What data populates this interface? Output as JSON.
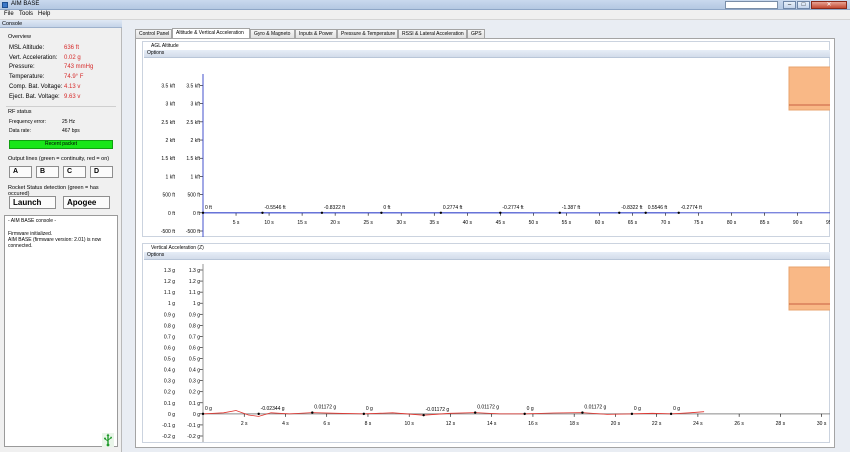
{
  "window": {
    "title": "AIM BASE"
  },
  "menu": [
    "File",
    "Tools",
    "Help"
  ],
  "console": {
    "header": "Console",
    "overview_label": "Overview",
    "fields": [
      {
        "label": "MSL Altitude:",
        "value": "636 ft"
      },
      {
        "label": "Vert. Acceleration:",
        "value": "0.02 g"
      },
      {
        "label": "Pressure:",
        "value": "743 mmHg"
      },
      {
        "label": "Temperature:",
        "value": "74.9° F"
      },
      {
        "label": "Comp. Bat. Voltage:",
        "value": "4.13 v"
      },
      {
        "label": "Eject. Bat. Voltage:",
        "value": "9.63 v"
      }
    ],
    "rf_label": "RF status",
    "rf": [
      {
        "label": "Frequency error:",
        "value": "25 Hz"
      },
      {
        "label": "Data rate:",
        "value": "467 bps"
      }
    ],
    "recent_packet": "Recent packet",
    "output_label": "Output lines (green = continuity, red = on)",
    "output_buttons": [
      "A",
      "B",
      "C",
      "D"
    ],
    "detect_label": "Rocket Status detection (green = has occured)",
    "launch": "Launch",
    "apogee": "Apogee",
    "log_title": "- AIM BASE console -",
    "log_text": "Firmware initialized.\nAIM BASE (firmware version: 2.01) is now connected."
  },
  "tabs": [
    "Control Panel",
    "Altitude & Vertical Acceleration",
    "Gyro & Magneto",
    "Inputs & Power",
    "Pressure & Temperature",
    "RSSI & Lateral Acceleration",
    "GPS"
  ],
  "active_tab": 1,
  "colors": {
    "accent_line": "#2f3fc9",
    "accel_line": "#e0302a",
    "overview_box": "#f9b886",
    "recent_packet": "#19e619",
    "value_text": "#d62a2a"
  },
  "chart_data": [
    {
      "type": "line",
      "title": "AGL Altitude",
      "options_label": "Options",
      "y_ticks": [
        "-500 ft",
        "0 ft",
        "500 ft",
        "1 kft",
        "1.5 kft",
        "2 kft",
        "2.5 kft",
        "3 kft",
        "3.5 kft"
      ],
      "y_tick_values": [
        -500,
        0,
        500,
        1000,
        1500,
        2000,
        2500,
        3000,
        3500
      ],
      "x_ticks": [
        "5 s",
        "10 s",
        "15 s",
        "20 s",
        "25 s",
        "30 s",
        "35 s",
        "40 s",
        "45 s",
        "50 s",
        "55 s",
        "60 s",
        "65 s",
        "70 s",
        "75 s",
        "80 s",
        "85 s",
        "90 s",
        "95 s"
      ],
      "x_tick_values": [
        5,
        10,
        15,
        20,
        25,
        30,
        35,
        40,
        45,
        50,
        55,
        60,
        65,
        70,
        75,
        80,
        85,
        90,
        95
      ],
      "xlim": [
        0,
        95.5
      ],
      "ylim": [
        -500,
        3650
      ],
      "point_labels": [
        {
          "x": 0,
          "y": 0,
          "label": "0 ft"
        },
        {
          "x": 9,
          "y": 0,
          "label": "-0.5546 ft"
        },
        {
          "x": 18,
          "y": 0,
          "label": "-0.8322 ft"
        },
        {
          "x": 27,
          "y": 0,
          "label": "0 ft"
        },
        {
          "x": 36,
          "y": 0,
          "label": "0.2774 ft"
        },
        {
          "x": 45,
          "y": 0,
          "label": "-0.2774 ft"
        },
        {
          "x": 54,
          "y": 0,
          "label": "-1.387 ft"
        },
        {
          "x": 63,
          "y": 0,
          "label": "-0.8322 ft"
        },
        {
          "x": 67,
          "y": 0,
          "label": "0.5546 ft"
        },
        {
          "x": 72,
          "y": 0,
          "label": "-0.2774 ft"
        }
      ],
      "series": [
        {
          "values": [
            [
              0,
              0
            ],
            [
              9,
              -0.55
            ],
            [
              18,
              -0.83
            ],
            [
              27,
              0
            ],
            [
              36,
              0.28
            ],
            [
              45,
              -0.28
            ],
            [
              54,
              -1.39
            ],
            [
              63,
              -0.83
            ],
            [
              67,
              0.55
            ],
            [
              72,
              -0.28
            ]
          ]
        }
      ]
    },
    {
      "type": "line",
      "title": "Vertical Acceleration (Z)",
      "options_label": "Options",
      "y_ticks": [
        "-0.2 g",
        "-0.1 g",
        "0 g",
        "0.1 g",
        "0.2 g",
        "0.3 g",
        "0.4 g",
        "0.5 g",
        "0.6 g",
        "0.7 g",
        "0.8 g",
        "0.9 g",
        "1 g",
        "1.1 g",
        "1.2 g",
        "1.3 g"
      ],
      "y_tick_values": [
        -0.2,
        -0.1,
        0,
        0.1,
        0.2,
        0.3,
        0.4,
        0.5,
        0.6,
        0.7,
        0.8,
        0.9,
        1.0,
        1.1,
        1.2,
        1.3
      ],
      "x_ticks": [
        "2 s",
        "4 s",
        "6 s",
        "8 s",
        "10 s",
        "12 s",
        "14 s",
        "16 s",
        "18 s",
        "20 s",
        "22 s",
        "24 s",
        "26 s",
        "28 s",
        "30 s"
      ],
      "x_tick_values": [
        2,
        4,
        6,
        8,
        10,
        12,
        14,
        16,
        18,
        20,
        22,
        24,
        26,
        28,
        30
      ],
      "xlim": [
        0,
        30.6
      ],
      "ylim": [
        -0.2,
        1.3
      ],
      "point_labels": [
        {
          "x": 0,
          "y": 0,
          "label": "0 g"
        },
        {
          "x": 2.7,
          "y": 0,
          "label": "-0.02344 g"
        },
        {
          "x": 5.3,
          "y": 0.0117,
          "label": "0.01172 g"
        },
        {
          "x": 7.8,
          "y": 0,
          "label": "0 g"
        },
        {
          "x": 10.7,
          "y": -0.0117,
          "label": "-0.01172 g"
        },
        {
          "x": 13.2,
          "y": 0.0117,
          "label": "0.01172 g"
        },
        {
          "x": 15.6,
          "y": 0,
          "label": "0 g"
        },
        {
          "x": 18.4,
          "y": 0.0117,
          "label": "0.01172 g"
        },
        {
          "x": 20.8,
          "y": 0,
          "label": "0 g"
        },
        {
          "x": 22.7,
          "y": 0,
          "label": "0 g"
        }
      ],
      "series": [
        {
          "values": [
            [
              0,
              0
            ],
            [
              1,
              0.01
            ],
            [
              1.6,
              0.03
            ],
            [
              2.2,
              -0.01
            ],
            [
              2.7,
              -0.023
            ],
            [
              3.3,
              0.01
            ],
            [
              4.2,
              0.0
            ],
            [
              5.3,
              0.0117
            ],
            [
              6.5,
              0.005
            ],
            [
              7.8,
              0
            ],
            [
              9.2,
              0.01
            ],
            [
              10.7,
              -0.0117
            ],
            [
              12,
              0.005
            ],
            [
              13.2,
              0.0117
            ],
            [
              14.4,
              0.0
            ],
            [
              15.6,
              0
            ],
            [
              17,
              0.008
            ],
            [
              18.4,
              0.0117
            ],
            [
              19.6,
              -0.005
            ],
            [
              20.8,
              0
            ],
            [
              21.8,
              0.005
            ],
            [
              22.7,
              0
            ],
            [
              23.6,
              0.01
            ],
            [
              24.3,
              0.02
            ]
          ]
        }
      ]
    }
  ]
}
